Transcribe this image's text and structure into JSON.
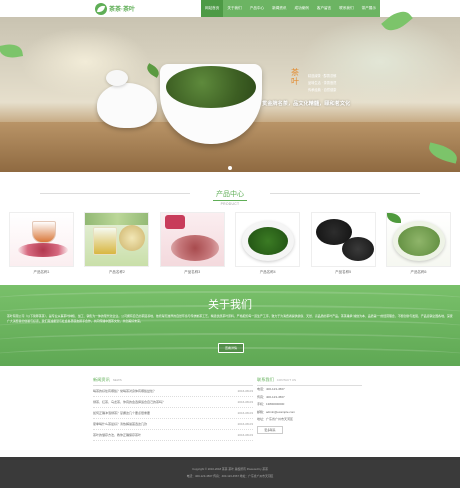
{
  "header": {
    "logo_text": "茶茶·茶叶",
    "nav": [
      "网站首页",
      "关于我们",
      "产品中心",
      "新闻资讯",
      "成功案例",
      "客户留言",
      "联系我们",
      "茶产展示"
    ]
  },
  "hero": {
    "tea_char": "茶叶",
    "lines": [
      "精选绿茶 · 醇香浓郁",
      "品味生活 · 茶香悠然",
      "传承经典 · 自然健康"
    ],
    "slogan": "贯金牌名茶，品文化精髓，颐和茗文化"
  },
  "products_section": {
    "title": "产品中心",
    "subtitle": "PRODUCT",
    "items": [
      {
        "caption": "产品名称1"
      },
      {
        "caption": "产品名称2"
      },
      {
        "caption": "产品名称3"
      },
      {
        "caption": "产品名称4"
      },
      {
        "caption": "产品名称5"
      },
      {
        "caption": "产品名称6"
      }
    ]
  },
  "about": {
    "title": "关于我们",
    "text": "茶叶有限公司（以下简称茶茶），是专业从事茶叶种植、加工、销售为一体的现代化企业。公司拥有自己的茶园基地，依托得天独厚的自然环境与传统制茶工艺，精选优质茶叶原料，严格把控每一道生产工序，致力于为消费者提供健康、天然、高品质的茶叶产品。茶茶秉承“诚信为本、品质第一”的经营理念，不断创新与发展，产品远销全国各地，深受广大消费者的信赖与好评。我们真诚希望与社会各界朋友携手合作，共同传播中国茶文化，共创美好未来。",
    "button": "查看详情"
  },
  "news": {
    "title": "新闻资讯",
    "title_en": "NEWS",
    "rows": [
      {
        "title": "喝茶的好处有哪些？常喝茶对身体有哪些益处？",
        "date": "2016-08-03"
      },
      {
        "title": "绿茶、红茶、乌龙茶，你真的会选择适合自己的茶吗？",
        "date": "2016-08-03"
      },
      {
        "title": "如何正确冲泡绿茶？掌握这几个要点很重要",
        "date": "2016-08-03"
      },
      {
        "title": "夏季喝什么茶最好？清热解暑首选这几款",
        "date": "2016-08-03"
      },
      {
        "title": "茶叶的储存方法，教你正确保存茶叶",
        "date": "2016-08-03"
      }
    ]
  },
  "contact": {
    "title": "联系我们",
    "title_en": "CONTACT US",
    "rows": [
      "电话：400-123-4567",
      "传真：400-123-4567",
      "手机：13800000000",
      "邮箱：admin@example.com",
      "地址：广东省广州市天河区"
    ],
    "button": "更多联系"
  },
  "footer": {
    "line1": "Copyright © 2016-2018 茶茶·茶叶 版权所有 Powered by 茶茶",
    "line2": "电话：400-123-4567  传真：400-123-4567  地址：广东省广州市天河区"
  }
}
